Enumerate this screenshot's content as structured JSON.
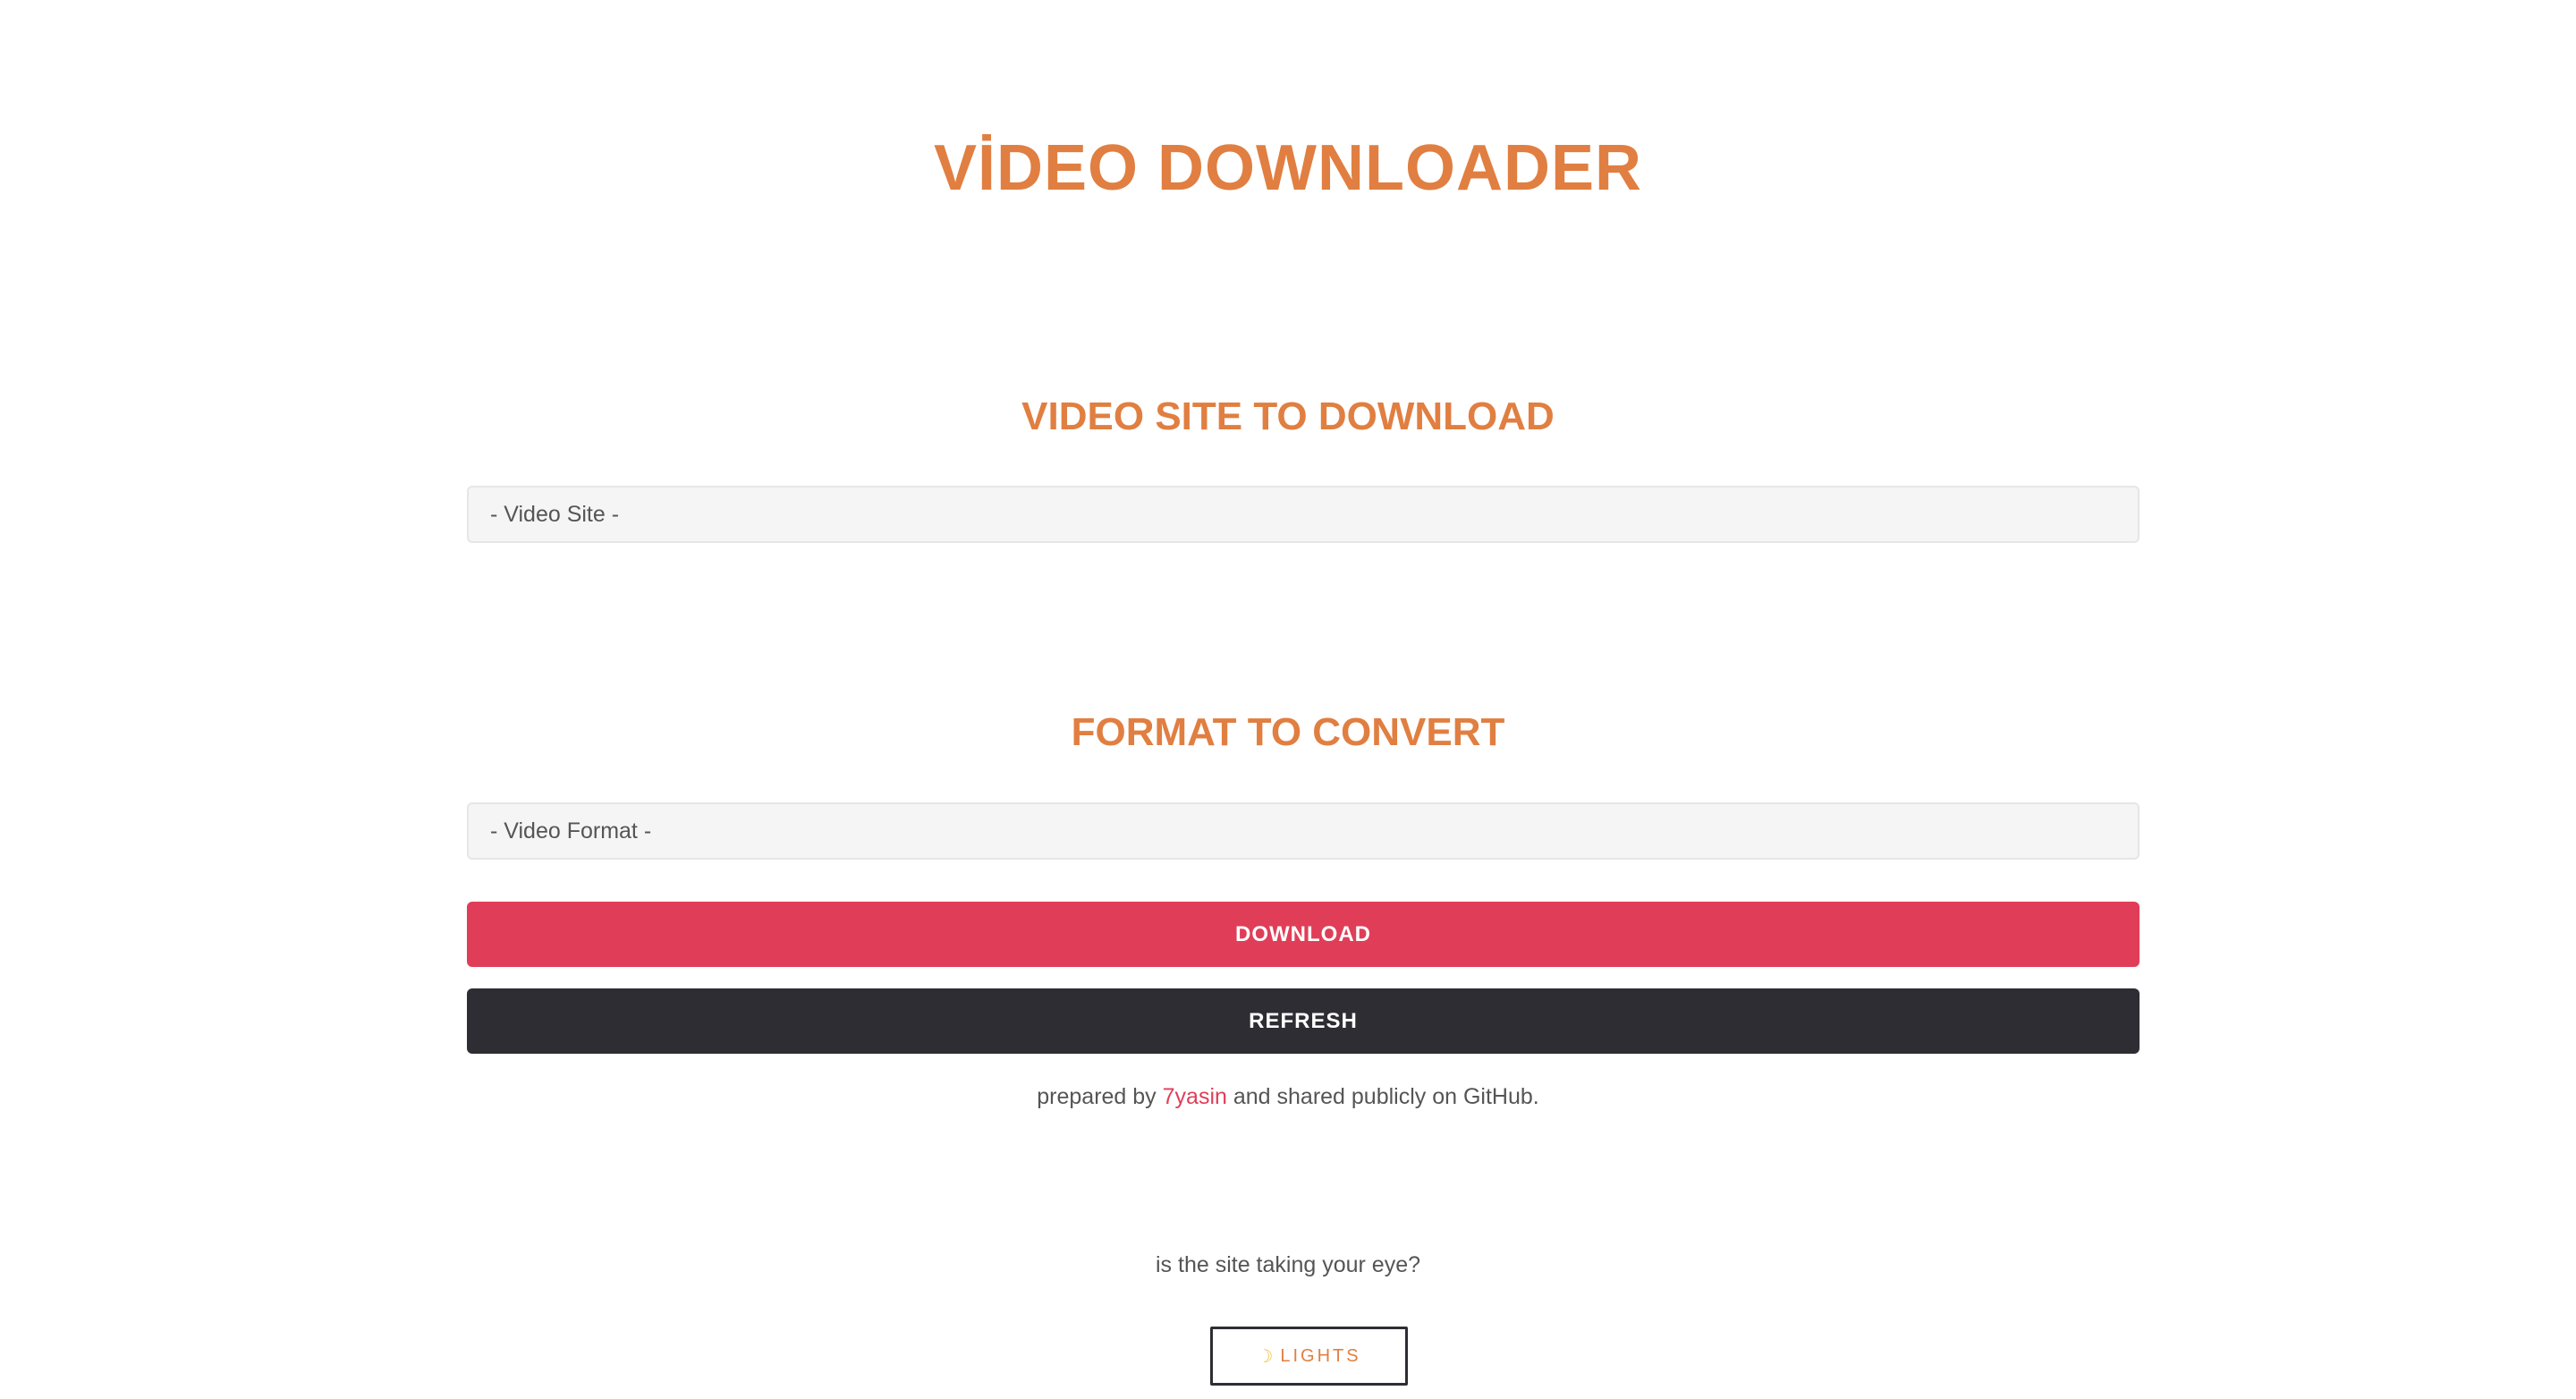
{
  "header": {
    "title": "VİDEO DOWNLOADER"
  },
  "site_section": {
    "heading": "VIDEO SITE TO DOWNLOAD",
    "select_value": "- Video Site -"
  },
  "format_section": {
    "heading": "FORMAT TO CONVERT",
    "select_value": "- Video Format -"
  },
  "actions": {
    "download_label": "DOWNLOAD",
    "refresh_label": "REFRESH"
  },
  "credit": {
    "prefix": "prepared by",
    "author": "7yasin",
    "suffix": "and shared publicly on GitHub."
  },
  "theme": {
    "question": "is the site taking your eye?",
    "lights_icon": "☽",
    "lights_label": "LIGHTS"
  },
  "colors": {
    "accent": "#e07f41",
    "download": "#e03e58",
    "refresh": "#2e2d33",
    "link": "#e03e58"
  }
}
